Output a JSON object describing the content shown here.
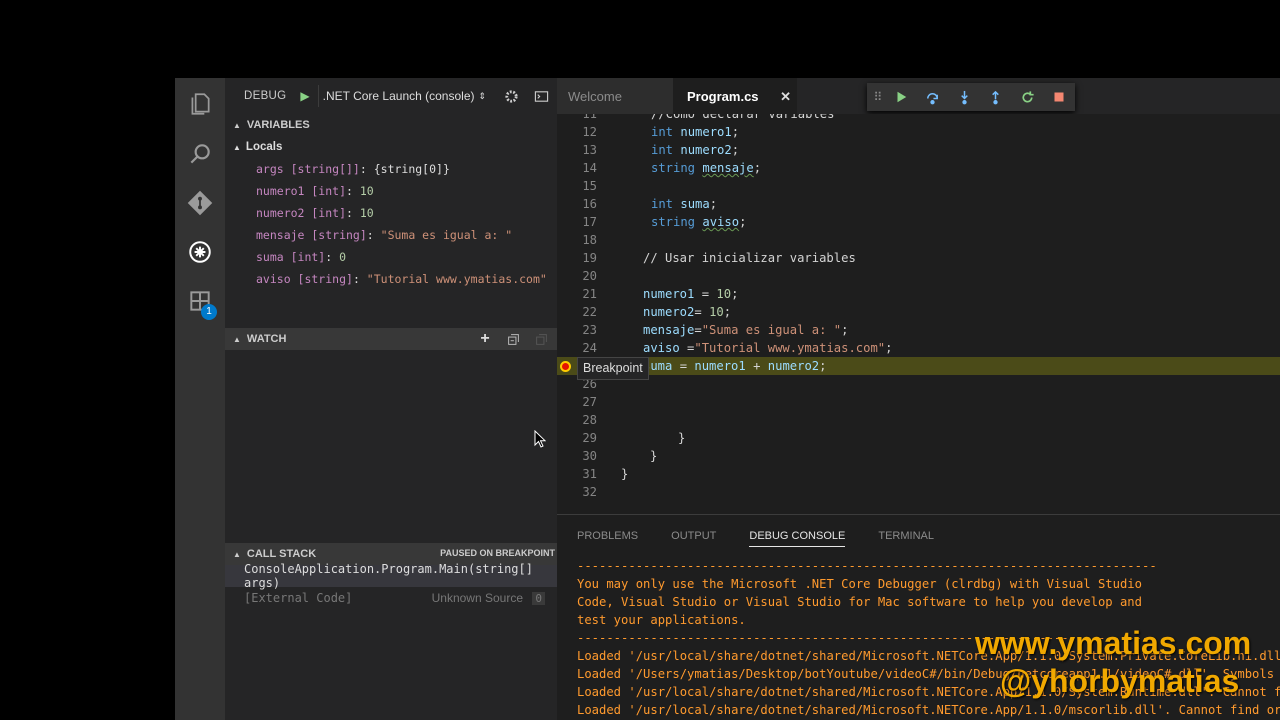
{
  "debug": {
    "title": "DEBUG",
    "config": ".NET Core Launch (console)"
  },
  "variables": {
    "header": "VARIABLES",
    "group": "Locals",
    "items": [
      {
        "name": "args [string[]]",
        "value": "{string[0]}"
      },
      {
        "name": "numero1 [int]",
        "value": "10"
      },
      {
        "name": "numero2 [int]",
        "value": "10"
      },
      {
        "name": "mensaje [string]",
        "value": "\"Suma es igual a: \""
      },
      {
        "name": "suma [int]",
        "value": "0"
      },
      {
        "name": "aviso [string]",
        "value": "\"Tutorial www.ymatias.com\""
      }
    ]
  },
  "watch": {
    "header": "WATCH"
  },
  "callstack": {
    "header": "CALL STACK",
    "status": "PAUSED ON BREAKPOINT",
    "frames": [
      {
        "label": "ConsoleApplication.Program.Main(string[] args)"
      },
      {
        "label": "[External Code]",
        "source": "Unknown Source",
        "line": "0"
      }
    ]
  },
  "activity": {
    "badge": "1"
  },
  "tabs": [
    {
      "label": "Welcome"
    },
    {
      "label": "Program.cs"
    }
  ],
  "code": {
    "lines": [
      {
        "n": "11",
        "text": "//Como declarar variables"
      },
      {
        "n": "12",
        "text": "int numero1;"
      },
      {
        "n": "13",
        "text": "int numero2;"
      },
      {
        "n": "14",
        "text": "string mensaje;"
      },
      {
        "n": "15",
        "text": ""
      },
      {
        "n": "16",
        "text": "int suma;"
      },
      {
        "n": "17",
        "text": "string aviso;"
      },
      {
        "n": "18",
        "text": ""
      },
      {
        "n": "19",
        "text": "// Usar inicializar variables"
      },
      {
        "n": "20",
        "text": ""
      },
      {
        "n": "21",
        "text": "numero1 = 10;"
      },
      {
        "n": "22",
        "text": "numero2= 10;"
      },
      {
        "n": "23",
        "text": "mensaje=\"Suma es igual a: \";"
      },
      {
        "n": "24",
        "text": "aviso =\"Tutorial www.ymatias.com\";"
      },
      {
        "n": "25",
        "text": "suma = numero1 + numero2;"
      },
      {
        "n": "26",
        "text": ""
      },
      {
        "n": "27",
        "text": ""
      },
      {
        "n": "28",
        "text": ""
      },
      {
        "n": "29",
        "text": "}"
      },
      {
        "n": "30",
        "text": "}"
      },
      {
        "n": "31",
        "text": "}"
      },
      {
        "n": "32",
        "text": ""
      }
    ],
    "breakpoint_tooltip": "Breakpoint"
  },
  "panel": {
    "tabs": [
      "PROBLEMS",
      "OUTPUT",
      "DEBUG CONSOLE",
      "TERMINAL"
    ],
    "active_tab": "DEBUG CONSOLE",
    "console": [
      "-------------------------------------------------------------------------------",
      "You may only use the Microsoft .NET Core Debugger (clrdbg) with Visual Studio",
      "Code, Visual Studio or Visual Studio for Mac software to help you develop and",
      "test your applications.",
      "-------------------------------------------------------------------------------",
      "Loaded '/usr/local/share/dotnet/shared/Microsoft.NETCore.App/1.1.0/System.Private.CoreLib.ni.dll'. Skipped loading symbols.",
      "Loaded '/Users/ymatias/Desktop/botYoutube/videoC#/bin/Debug/netcoreapp1.1/videoC#.dll'. Symbols loaded.",
      "Loaded '/usr/local/share/dotnet/shared/Microsoft.NETCore.App/1.1.0/System.Runtime.dll'. Cannot find or open the PDB file.",
      "Loaded '/usr/local/share/dotnet/shared/Microsoft.NETCore.App/1.1.0/mscorlib.dll'. Cannot find or open the PDB file."
    ]
  },
  "watermark": {
    "line1": "www.ymatias.com",
    "line2": "@yhorbymatias"
  },
  "colors": {
    "accent": "#007acc",
    "breakpoint": "#e51400",
    "console_text": "#ff9a2e",
    "current_line": "#4b4b18",
    "watermark": "#f0a800"
  }
}
